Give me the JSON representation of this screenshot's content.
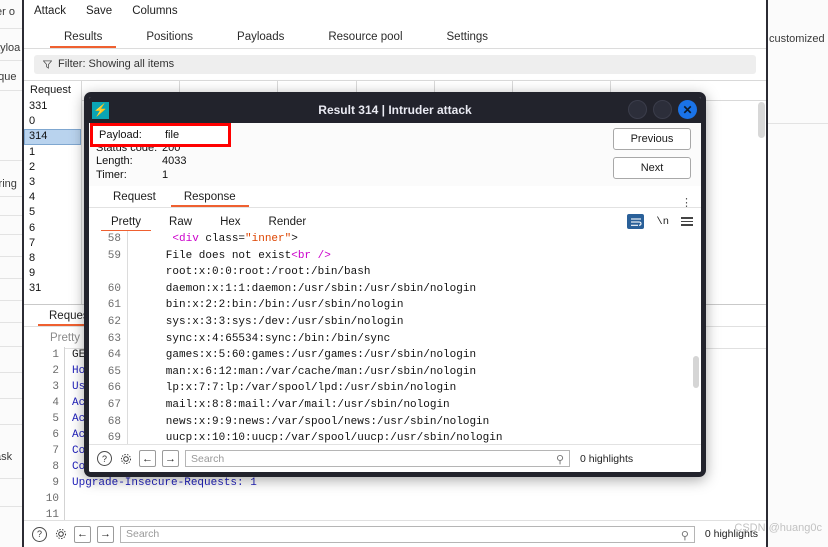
{
  "background": {
    "left_fragments": [
      "er o",
      "ayloa",
      "eque",
      "string",
      "task"
    ],
    "right_fragments": [
      "customized in"
    ],
    "watermark": "CSDN @huang0c"
  },
  "window": {
    "menubar": [
      {
        "label": "Attack"
      },
      {
        "label": "Save"
      },
      {
        "label": "Columns"
      }
    ],
    "tabs": [
      {
        "label": "Results",
        "active": true
      },
      {
        "label": "Positions",
        "active": false
      },
      {
        "label": "Payloads",
        "active": false
      },
      {
        "label": "Resource pool",
        "active": false
      },
      {
        "label": "Settings",
        "active": false
      }
    ],
    "filter": {
      "icon": "funnel-icon",
      "label": "Filter: Showing all items"
    },
    "results_table": {
      "first_column_header": "Request",
      "request_ids": [
        "331",
        "0",
        "314",
        "1",
        "2",
        "3",
        "4",
        "5",
        "6",
        "7",
        "8",
        "9",
        "31"
      ],
      "selected_id": "314"
    },
    "lower_panel": {
      "tabs": [
        {
          "label": "Request",
          "active": true
        }
      ],
      "subtabs": [
        {
          "label": "Pretty",
          "active": true
        }
      ],
      "code_lines": [
        {
          "n": "1",
          "text": "GET /",
          "plain": true
        },
        {
          "n": "2",
          "text": "Host:",
          "plain": false
        },
        {
          "n": "3",
          "text": "User-",
          "plain": false
        },
        {
          "n": "4",
          "text": "Accep",
          "plain": false
        },
        {
          "n": "5",
          "text": "Accep",
          "plain": false
        },
        {
          "n": "6",
          "text": "Accep",
          "plain": false
        },
        {
          "n": "7",
          "text": "Conne",
          "plain": false
        },
        {
          "n": "8",
          "text": "Cooki",
          "plain": false
        },
        {
          "n": "9",
          "text": "Upgrade-Insecure-Requests: 1",
          "plain": false
        },
        {
          "n": "10",
          "text": "",
          "plain": false
        },
        {
          "n": "11",
          "text": "",
          "plain": false
        }
      ],
      "bottombar": {
        "help_icon": "question-mark-icon",
        "settings_icon": "gear-icon",
        "back_icon": "arrow-left-icon",
        "forward_icon": "arrow-right-icon",
        "search_placeholder": "Search",
        "search_icon": "magnifier-icon",
        "highlights": "0 highlights"
      }
    }
  },
  "modal": {
    "logo_icon": "burp-lightning-icon",
    "title": "Result 314 | Intruder attack",
    "window_buttons": [
      {
        "name": "minimize-button",
        "label": ""
      },
      {
        "name": "maximize-button",
        "label": ""
      },
      {
        "name": "close-button",
        "label": "✕"
      }
    ],
    "meta": {
      "payload_key": "Payload:",
      "payload_value": "file",
      "status_key": "Status code:",
      "status_value": "200",
      "length_key": "Length:",
      "length_value": "4033",
      "timer_key": "Timer:",
      "timer_value": "1"
    },
    "nav": {
      "previous": "Previous",
      "next": "Next"
    },
    "tabs": [
      {
        "label": "Request",
        "active": false
      },
      {
        "label": "Response",
        "active": true
      }
    ],
    "subtabs": [
      {
        "label": "Pretty",
        "active": true
      },
      {
        "label": "Raw",
        "active": false
      },
      {
        "label": "Hex",
        "active": false
      },
      {
        "label": "Render",
        "active": false
      }
    ],
    "subtools": {
      "wrap_icon": "word-wrap-icon",
      "newline_icon": "newline-icon",
      "menu_icon": "hamburger-menu-icon"
    },
    "response_lines": [
      {
        "n": "58",
        "segments": [
          {
            "t": "    ",
            "c": "plain"
          },
          {
            "t": "<div",
            "c": "tag"
          },
          {
            "t": " class=",
            "c": "attr"
          },
          {
            "t": "\"inner\"",
            "c": "str"
          },
          {
            "t": ">",
            "c": "attr"
          }
        ]
      },
      {
        "n": "59",
        "segments": [
          {
            "t": "   File does not exist",
            "c": "plain"
          },
          {
            "t": "<br />",
            "c": "tag"
          }
        ]
      },
      {
        "n": "",
        "segments": [
          {
            "t": "   root:x:0:0:root:/root:/bin/bash",
            "c": "plain"
          }
        ]
      },
      {
        "n": "60",
        "segments": [
          {
            "t": "   daemon:x:1:1:daemon:/usr/sbin:/usr/sbin/nologin",
            "c": "plain"
          }
        ]
      },
      {
        "n": "61",
        "segments": [
          {
            "t": "   bin:x:2:2:bin:/bin:/usr/sbin/nologin",
            "c": "plain"
          }
        ]
      },
      {
        "n": "62",
        "segments": [
          {
            "t": "   sys:x:3:3:sys:/dev:/usr/sbin/nologin",
            "c": "plain"
          }
        ]
      },
      {
        "n": "63",
        "segments": [
          {
            "t": "   sync:x:4:65534:sync:/bin:/bin/sync",
            "c": "plain"
          }
        ]
      },
      {
        "n": "64",
        "segments": [
          {
            "t": "   games:x:5:60:games:/usr/games:/usr/sbin/nologin",
            "c": "plain"
          }
        ]
      },
      {
        "n": "65",
        "segments": [
          {
            "t": "   man:x:6:12:man:/var/cache/man:/usr/sbin/nologin",
            "c": "plain"
          }
        ]
      },
      {
        "n": "66",
        "segments": [
          {
            "t": "   lp:x:7:7:lp:/var/spool/lpd:/usr/sbin/nologin",
            "c": "plain"
          }
        ]
      },
      {
        "n": "67",
        "segments": [
          {
            "t": "   mail:x:8:8:mail:/var/mail:/usr/sbin/nologin",
            "c": "plain"
          }
        ]
      },
      {
        "n": "68",
        "segments": [
          {
            "t": "   news:x:9:9:news:/var/spool/news:/usr/sbin/nologin",
            "c": "plain"
          }
        ]
      },
      {
        "n": "69",
        "segments": [
          {
            "t": "   uucp:x:10:10:uucp:/var/spool/uucp:/usr/sbin/nologin",
            "c": "plain"
          }
        ]
      }
    ],
    "bottombar": {
      "help_icon": "question-mark-icon",
      "settings_icon": "gear-icon",
      "back_icon": "arrow-left-icon",
      "forward_icon": "arrow-right-icon",
      "search_placeholder": "Search",
      "search_icon": "magnifier-icon",
      "highlights": "0 highlights"
    }
  },
  "colors": {
    "accent": "#ef6030",
    "titlebar": "#22232c",
    "close": "#1a73e8",
    "logo": "#0aa5b5",
    "highlight_box": "#ff0000",
    "selection": "#b9d3ee"
  }
}
